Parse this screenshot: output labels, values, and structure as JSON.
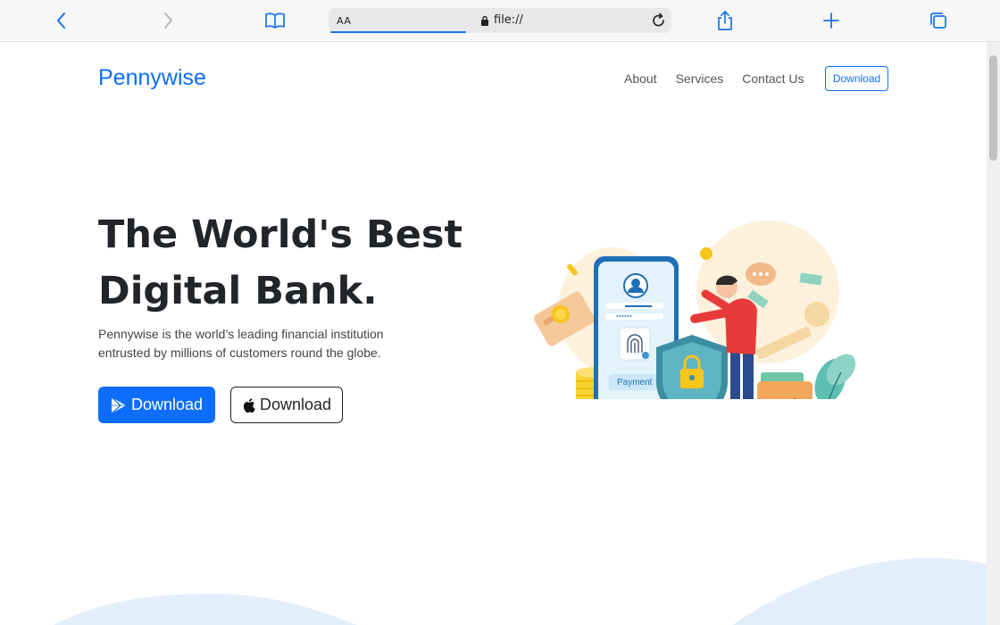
{
  "browser": {
    "reader_label": "AA",
    "url": "file://"
  },
  "navbar": {
    "brand": "Pennywise",
    "links": [
      "About",
      "Services",
      "Contact Us"
    ],
    "download_label": "Download"
  },
  "hero": {
    "title_line1": "The World's Best",
    "title_line2": "Digital Bank.",
    "description": "Pennywise is the world’s leading financial institution entrusted by millions of customers round the globe.",
    "play_button_label": "Download",
    "apple_button_label": "Download"
  },
  "illustration": {
    "payment_label": "Payment"
  },
  "colors": {
    "primary": "#0d6efd",
    "wave": "#e3eefc"
  }
}
